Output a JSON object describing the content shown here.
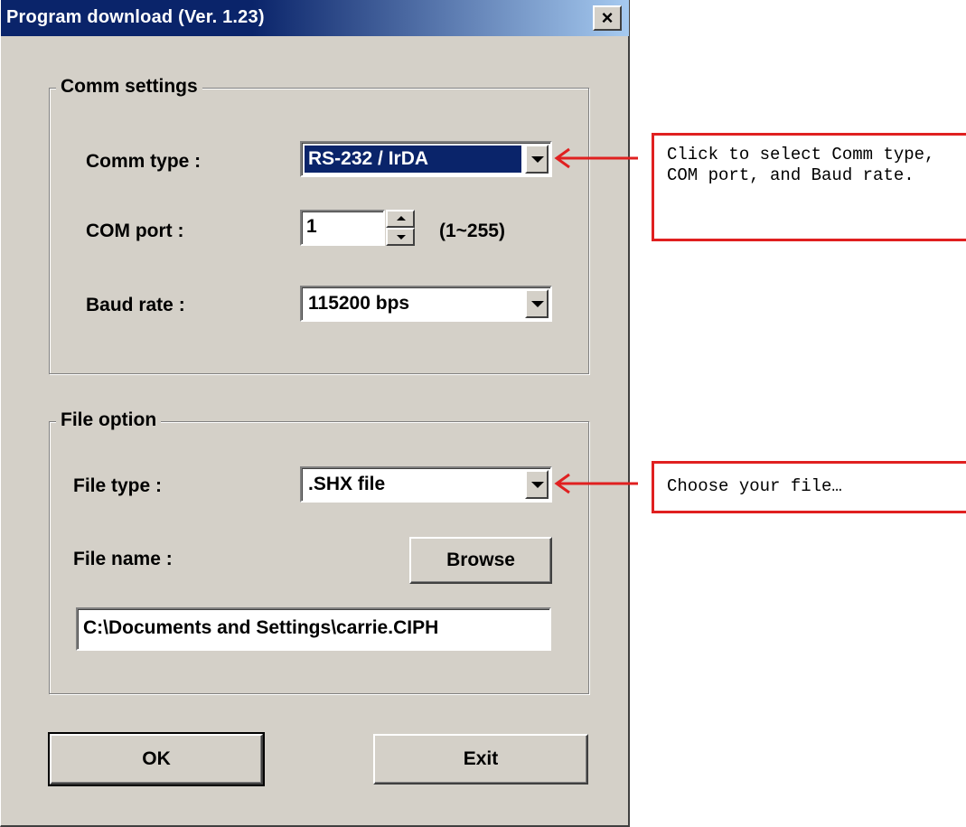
{
  "window": {
    "title": "Program download  (Ver. 1.23)",
    "close_glyph": "×",
    "close_icon": "close-icon"
  },
  "comm_settings": {
    "legend": "Comm settings",
    "comm_type": {
      "label": "Comm type :",
      "value": "RS-232 / IrDA"
    },
    "com_port": {
      "label": "COM port :",
      "value": "1",
      "range": "(1~255)"
    },
    "baud_rate": {
      "label": "Baud rate :",
      "value": "115200 bps"
    }
  },
  "file_option": {
    "legend": "File option",
    "file_type": {
      "label": "File type :",
      "value": ".SHX file"
    },
    "file_name": {
      "label": "File name :",
      "browse_label": "Browse",
      "path": "C:\\Documents and Settings\\carrie.CIPH"
    }
  },
  "buttons": {
    "ok_label": "OK",
    "exit_label": "Exit"
  },
  "annotations": {
    "comm_note": "Click to select Comm type, COM port, and Baud rate.",
    "file_note": "Choose your file…"
  },
  "colors": {
    "dialog_bg": "#d4d0c8",
    "title_bar": "#0a246a",
    "selection": "#0a246a",
    "annotation": "#e02020"
  }
}
